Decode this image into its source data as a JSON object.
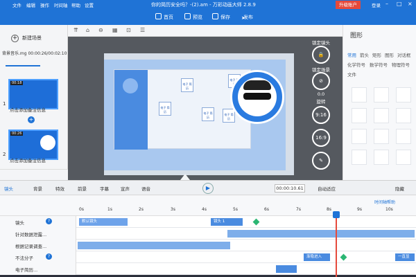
{
  "app": {
    "title": "你的简历安全吗？-(2).am - 万彩动画大师 2.8.9",
    "menus": [
      "文件",
      "编辑",
      "操作",
      "时间轴",
      "帮助",
      "设置"
    ],
    "upgrade": "升级账户",
    "login": "登录"
  },
  "toolbar": {
    "home": "首页",
    "preview": "预览",
    "save": "保存",
    "publish": "发布"
  },
  "scenes": {
    "new_scene": "新建场景",
    "bg_music": "背景音乐.mg  00:00:26/00:02:10",
    "items": [
      {
        "num": "1",
        "time": "00:18",
        "note": "点击添加备注信息"
      },
      {
        "num": "2",
        "time": "00:26",
        "note": "点击添加备注信息"
      }
    ]
  },
  "canvas": {
    "chips": [
      "电子\n简历",
      "电子\n简历",
      "电子\n简历",
      "电子\n简历",
      "电子\n简历"
    ],
    "right_controls": {
      "lock_lens": "锁定镜头",
      "lock_scene": "锁定场景",
      "rotate_value": "0.0",
      "rotate": "旋转",
      "ratio1": "9:16",
      "ratio2": "16:9"
    }
  },
  "right_panel": {
    "title": "图形",
    "tabs_row1": [
      "常用",
      "箭头",
      "矩形",
      "图形",
      "对话框"
    ],
    "tabs_row2": [
      "化学符号",
      "数学符号",
      "物理符号"
    ],
    "tabs_row3": [
      "文件"
    ]
  },
  "timeline_bar": {
    "items": [
      "镜头",
      "背景",
      "特效",
      "前景",
      "字幕",
      "宣声",
      "语音"
    ],
    "time": "00:00:10.61",
    "auto_adapt": "自动适应",
    "hide": "隐藏"
  },
  "ruler": {
    "help": "时间轴帮助",
    "ticks": [
      "0s",
      "1s",
      "2s",
      "3s",
      "4s",
      "5s",
      "6s",
      "7s",
      "8s",
      "9s",
      "10s"
    ]
  },
  "tracks": [
    {
      "name": "镜头",
      "clips": [
        "默认镜头",
        "镜头 1"
      ]
    },
    {
      "name": "针对数据泄露...",
      "clips": []
    },
    {
      "name": "根据记录调查...",
      "clips": []
    },
    {
      "name": "不法分子",
      "clips": [
        "渐隐进入",
        "一直显"
      ]
    },
    {
      "name": "电子简历...",
      "clips": []
    }
  ],
  "colors": {
    "brand": "#1f73d6",
    "upgrade": "#e6493b",
    "keyframe": "#2bb673"
  }
}
